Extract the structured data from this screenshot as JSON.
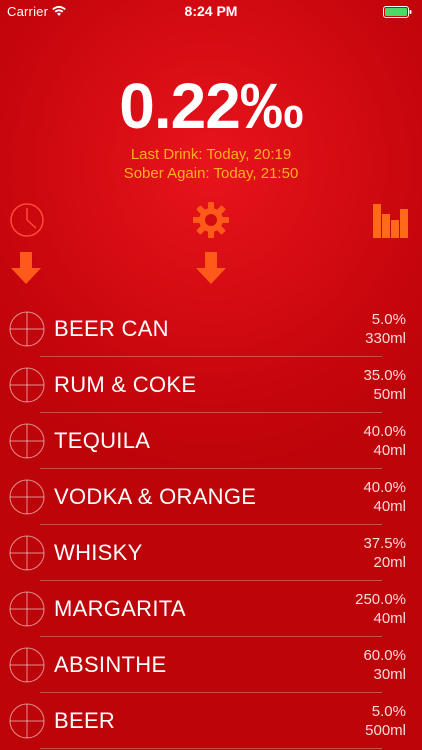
{
  "status_bar": {
    "carrier": "Carrier",
    "time": "8:24 PM",
    "wifi_icon": "wifi-icon",
    "battery_icon": "battery-icon",
    "battery_color": "#4cd964"
  },
  "bac": {
    "value": "0.22‰",
    "last_drink": "Last Drink: Today, 20:19",
    "sober_again": "Sober Again: Today, 21:50"
  },
  "toolbar": {
    "history_icon": "clock-icon",
    "settings_icon": "gear-icon",
    "stats_icon": "bar-chart-icon",
    "hint_icon": "arrow-down-icon"
  },
  "colors": {
    "background": "#d40b12",
    "accent": "#ffb020",
    "icon_orange": "#ff5a1a"
  },
  "drinks": [
    {
      "name": "BEER CAN",
      "abv": "5.0%",
      "volume": "330ml"
    },
    {
      "name": "RUM & COKE",
      "abv": "35.0%",
      "volume": "50ml"
    },
    {
      "name": "TEQUILA",
      "abv": "40.0%",
      "volume": "40ml"
    },
    {
      "name": "VODKA & ORANGE",
      "abv": "40.0%",
      "volume": "40ml"
    },
    {
      "name": "WHISKY",
      "abv": "37.5%",
      "volume": "20ml"
    },
    {
      "name": "MARGARITA",
      "abv": "250.0%",
      "volume": "40ml"
    },
    {
      "name": "ABSINTHE",
      "abv": "60.0%",
      "volume": "30ml"
    },
    {
      "name": "BEER",
      "abv": "5.0%",
      "volume": "500ml"
    }
  ]
}
